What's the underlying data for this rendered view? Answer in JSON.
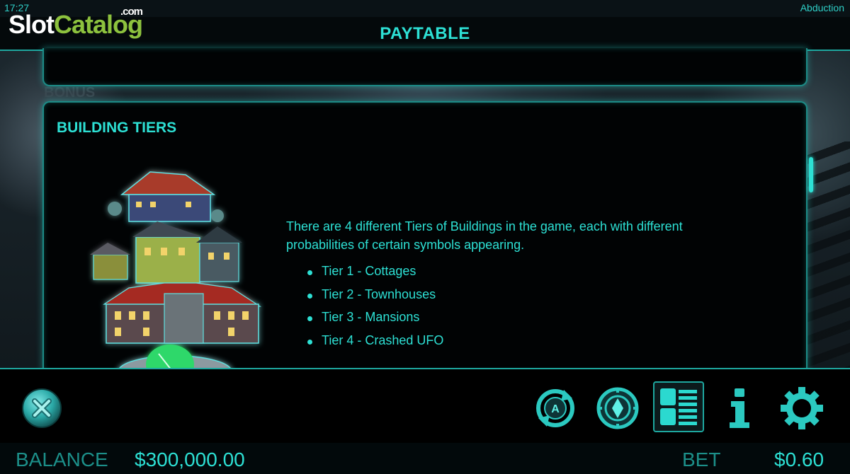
{
  "status": {
    "time": "17:27",
    "game_name": "Abduction"
  },
  "watermark": {
    "slot": "Slot",
    "catalog": "Catalog",
    "com": ".com"
  },
  "header": {
    "title": "PAYTABLE"
  },
  "background": {
    "bonus_ghost": "BONUS"
  },
  "section": {
    "title": "BUILDING TIERS",
    "description": "There are 4 different Tiers of Buildings in the game, each with different probabilities of certain symbols appearing.",
    "tiers": [
      "Tier 1 - Cottages",
      "Tier 2 - Townhouses",
      "Tier 3 - Mansions",
      "Tier 4 - Crashed UFO"
    ]
  },
  "toolbar": {
    "buttons": [
      "close-icon",
      "autoplay-icon",
      "bet-icon",
      "paytable-icon",
      "info-icon",
      "gear-icon"
    ]
  },
  "footer": {
    "balance_label": "BALANCE",
    "balance_value": "$300,000.00",
    "bet_label": "BET",
    "bet_value": "$0.60"
  },
  "colors": {
    "accent": "#2de0d4",
    "border": "#1c8b86",
    "panel": "#010304"
  }
}
